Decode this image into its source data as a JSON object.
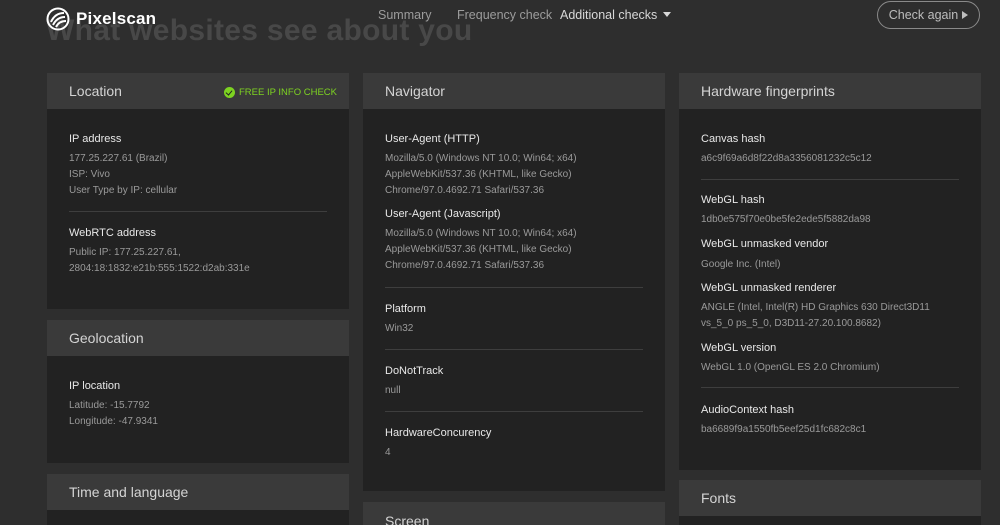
{
  "header": {
    "brand": "Pixelscan",
    "headline": "What websites see about you",
    "nav": [
      "Summary",
      "Frequency check",
      "Additional checks"
    ],
    "check_again": "Check again"
  },
  "location": {
    "title": "Location",
    "badge": "FREE IP INFO CHECK",
    "badge_color": "#7dd321",
    "ip_label": "IP address",
    "ip_lines": [
      "177.25.227.61 (Brazil)",
      "ISP: Vivo",
      "User Type by IP: cellular"
    ],
    "webrtc_label": "WebRTC address",
    "webrtc_lines": [
      "Public IP: 177.25.227.61,",
      "2804:18:1832:e21b:555:1522:d2ab:331e"
    ]
  },
  "geolocation": {
    "title": "Geolocation",
    "ip_location_label": "IP location",
    "lines": [
      "Latitude: -15.7792",
      "Longitude: -47.9341"
    ]
  },
  "time_language": {
    "title": "Time and language"
  },
  "navigator": {
    "title": "Navigator",
    "ua_http_label": "User-Agent (HTTP)",
    "ua_http_lines": [
      "Mozilla/5.0 (Windows NT 10.0; Win64; x64)",
      "AppleWebKit/537.36 (KHTML, like Gecko)",
      "Chrome/97.0.4692.71 Safari/537.36"
    ],
    "ua_js_label": "User-Agent (Javascript)",
    "ua_js_lines": [
      "Mozilla/5.0 (Windows NT 10.0; Win64; x64)",
      "AppleWebKit/537.36 (KHTML, like Gecko)",
      "Chrome/97.0.4692.71 Safari/537.36"
    ],
    "platform_label": "Platform",
    "platform_value": "Win32",
    "dnt_label": "DoNotTrack",
    "dnt_value": "null",
    "hc_label": "HardwareConcurency",
    "hc_value": "4"
  },
  "screen": {
    "title": "Screen"
  },
  "hardware": {
    "title": "Hardware fingerprints",
    "canvas_label": "Canvas hash",
    "canvas_value": "a6c9f69a6d8f22d8a3356081232c5c12",
    "webgl_label": "WebGL hash",
    "webgl_value": "1db0e575f70e0be5fe2ede5f5882da98",
    "vendor_label": "WebGL unmasked vendor",
    "vendor_value": "Google Inc. (Intel)",
    "renderer_label": "WebGL unmasked renderer",
    "renderer_lines": [
      "ANGLE (Intel, Intel(R) HD Graphics 630 Direct3D11",
      "vs_5_0 ps_5_0, D3D11-27.20.100.8682)"
    ],
    "version_label": "WebGL version",
    "version_value": "WebGL 1.0 (OpenGL ES 2.0 Chromium)",
    "audio_label": "AudioContext hash",
    "audio_value": "ba6689f9a1550fb5eef25d1fc682c8c1"
  },
  "fonts": {
    "title": "Fonts"
  }
}
